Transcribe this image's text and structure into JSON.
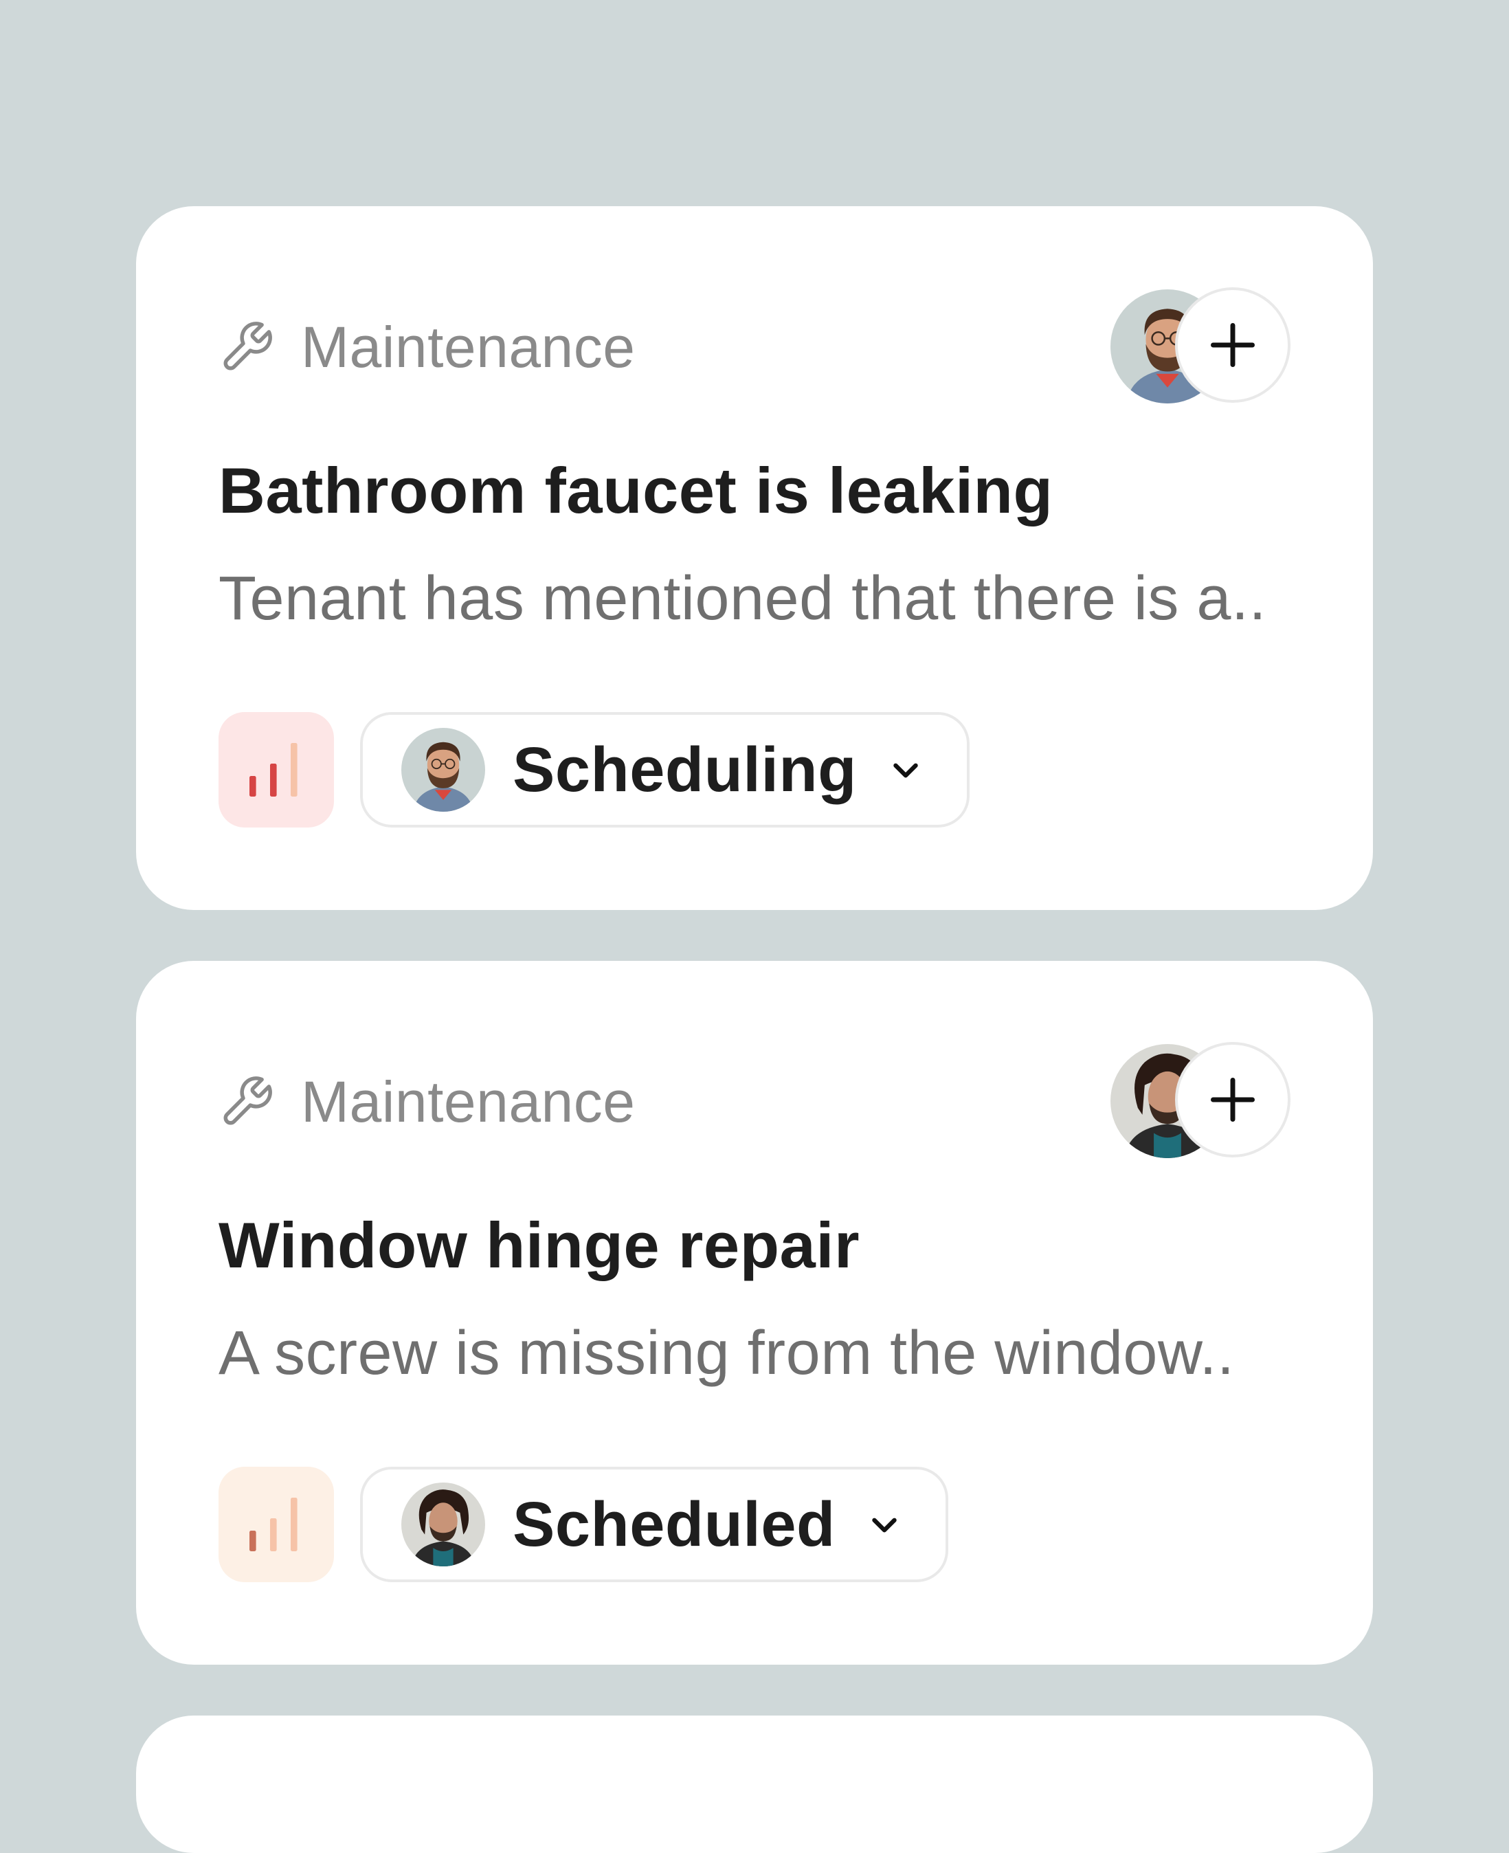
{
  "cards": [
    {
      "category": "Maintenance",
      "title": "Bathroom faucet is leaking",
      "description": "Tenant has mentioned that there is a..",
      "priority": "high",
      "status": "Scheduling",
      "assignee_avatar": "bearded-man-with-glasses"
    },
    {
      "category": "Maintenance",
      "title": "Window hinge repair",
      "description": "A screw is missing from the window..",
      "priority": "low",
      "status": "Scheduled",
      "assignee_avatar": "man-with-curly-hair"
    }
  ],
  "icons": {
    "category": "wrench-icon",
    "add": "plus-icon",
    "dropdown": "chevron-down-icon",
    "priority": "signal-bars-icon"
  },
  "colors": {
    "background": "#CFD8D9",
    "card": "#FFFFFF",
    "priority_high_bg": "#FDE6E6",
    "priority_high_bar": "#D64545",
    "priority_low_bg": "#FDF0E5",
    "priority_low_bar": "#C9715A"
  }
}
